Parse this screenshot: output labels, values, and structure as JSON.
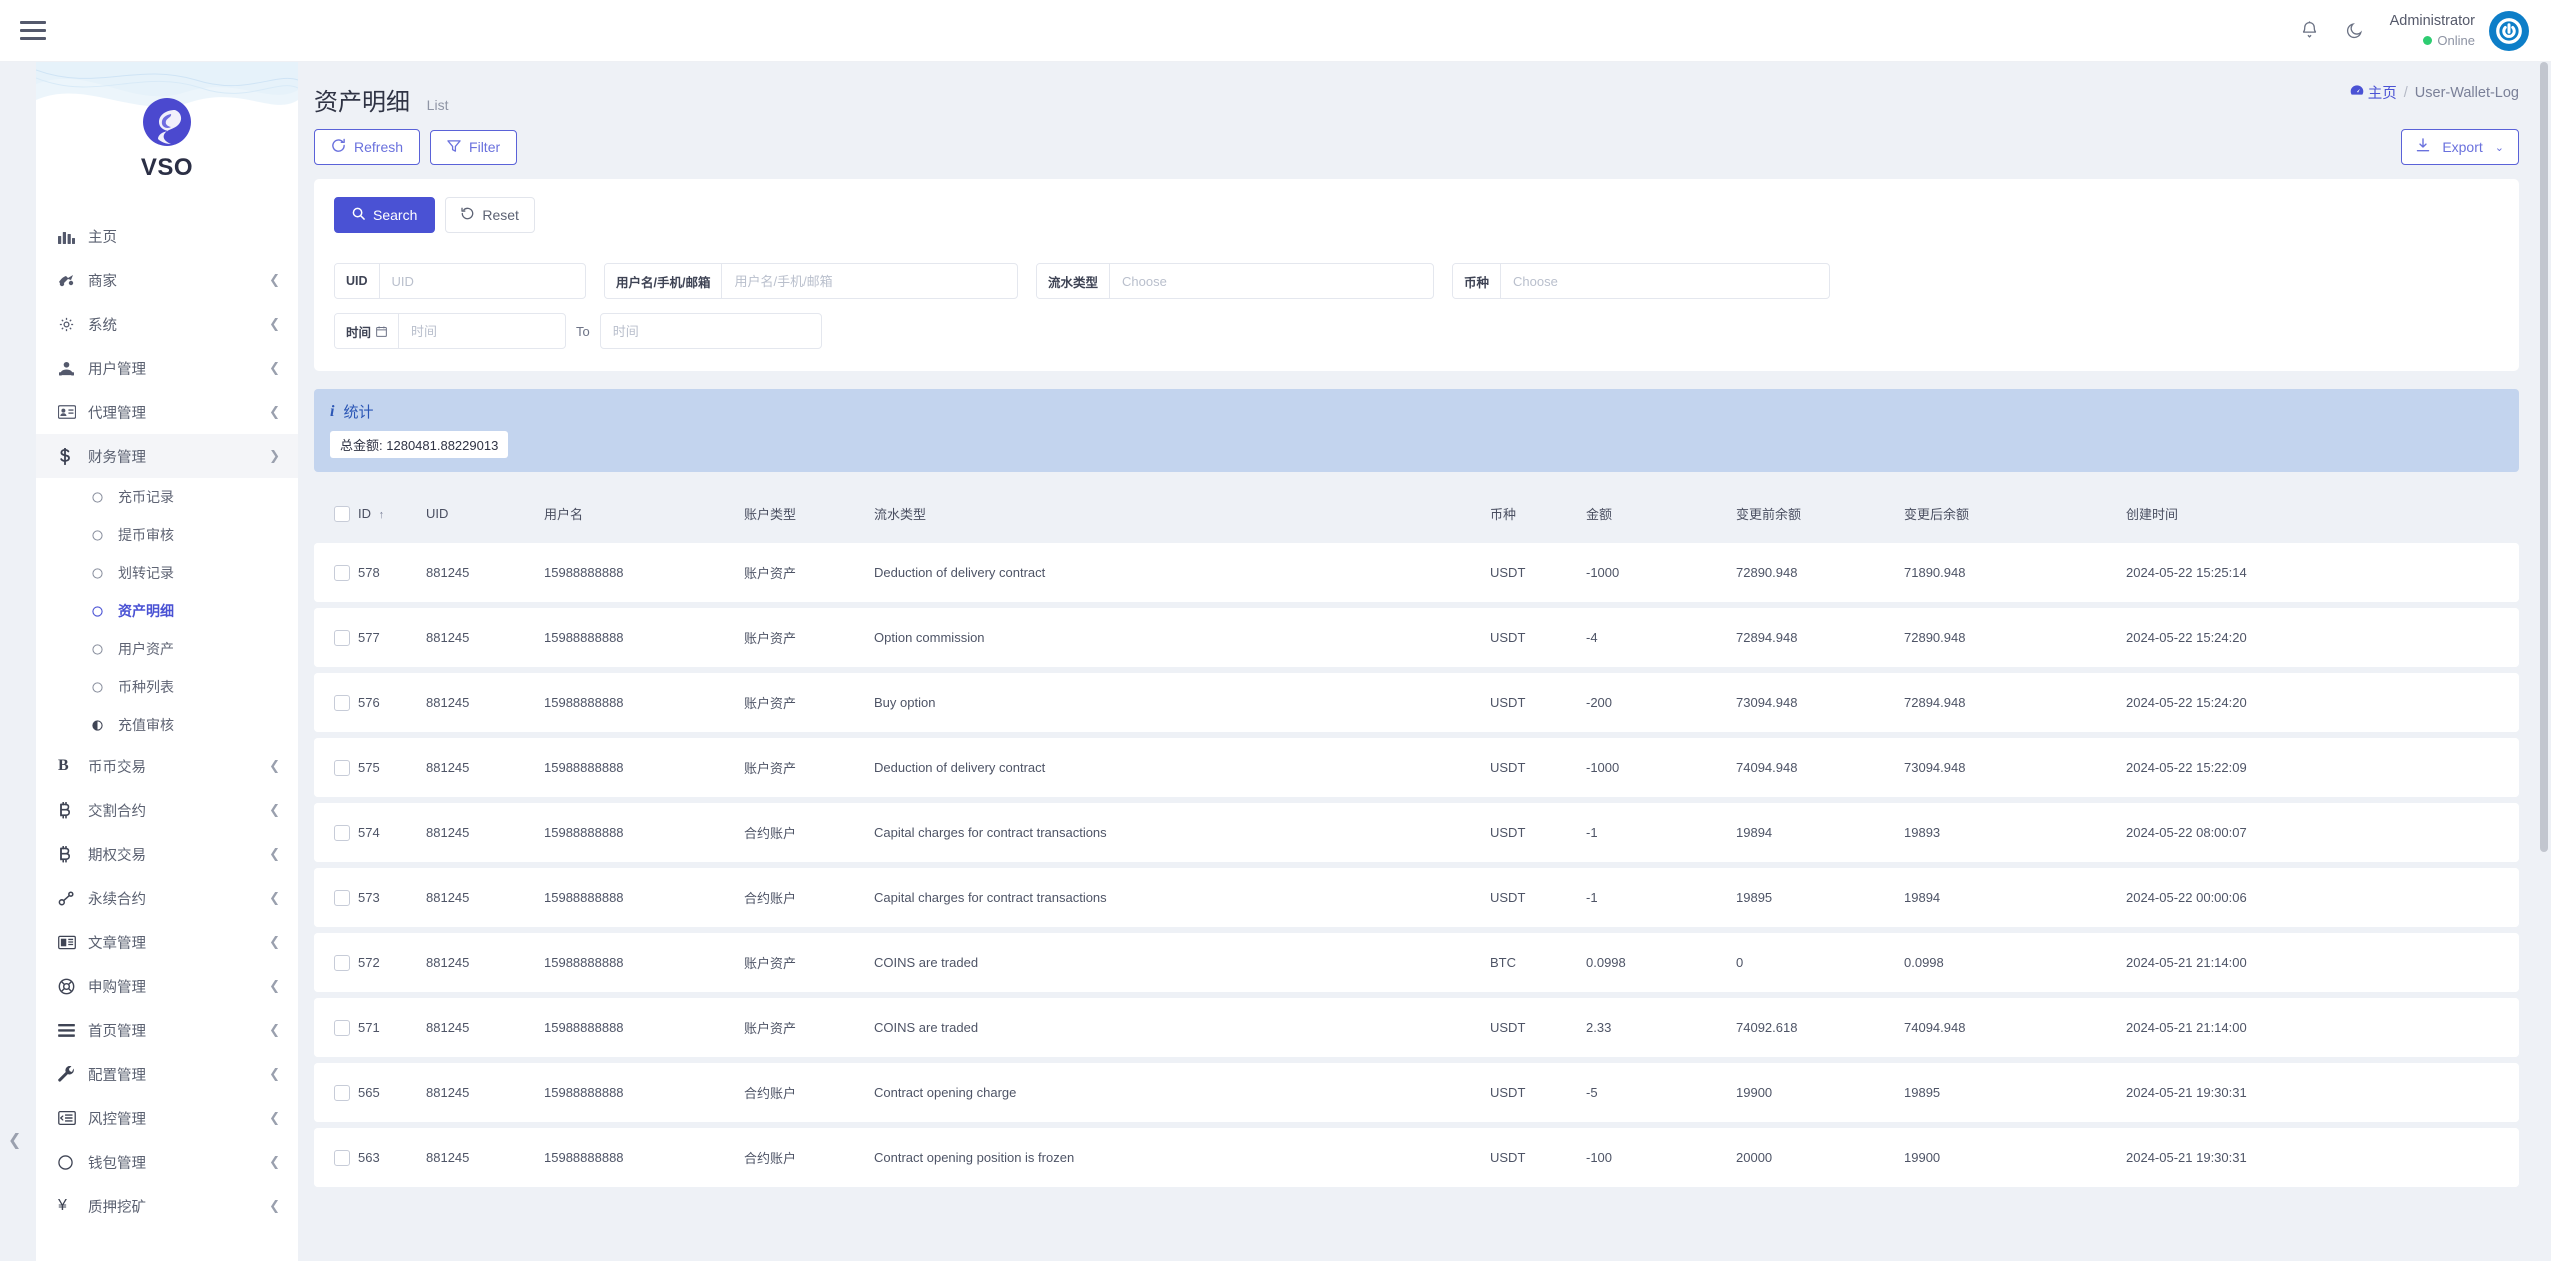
{
  "topbar": {
    "menu_toggle": "hamburger-menu",
    "bell_icon": "bell-icon",
    "theme_icon": "moon-icon",
    "user_name": "Administrator",
    "user_status": "Online"
  },
  "sidebar": {
    "brand": "VSO",
    "items": [
      {
        "label": "主页",
        "icon": "chart-bars-icon",
        "expandable": false
      },
      {
        "label": "商家",
        "icon": "merchant-icon",
        "expandable": true
      },
      {
        "label": "系统",
        "icon": "gear-icon",
        "expandable": true
      },
      {
        "label": "用户管理",
        "icon": "users-icon",
        "expandable": true
      },
      {
        "label": "代理管理",
        "icon": "id-card-icon",
        "expandable": true
      },
      {
        "label": "财务管理",
        "icon": "dollar-icon",
        "expandable": true,
        "active": true
      },
      {
        "label": "币币交易",
        "icon": "letter-b-icon",
        "expandable": true
      },
      {
        "label": "交割合约",
        "icon": "bitcoin-icon",
        "expandable": true
      },
      {
        "label": "期权交易",
        "icon": "bitcoin-icon",
        "expandable": true
      },
      {
        "label": "永续合约",
        "icon": "link-icon",
        "expandable": true
      },
      {
        "label": "文章管理",
        "icon": "newspaper-icon",
        "expandable": true
      },
      {
        "label": "申购管理",
        "icon": "lifebuoy-icon",
        "expandable": true
      },
      {
        "label": "首页管理",
        "icon": "list-icon",
        "expandable": true
      },
      {
        "label": "配置管理",
        "icon": "wrench-icon",
        "expandable": true
      },
      {
        "label": "风控管理",
        "icon": "indent-icon",
        "expandable": true
      },
      {
        "label": "钱包管理",
        "icon": "circle-icon",
        "expandable": true
      },
      {
        "label": "质押挖矿",
        "icon": "yen-icon",
        "expandable": true
      }
    ],
    "finance_submenu": [
      {
        "label": "充币记录",
        "icon": "circle-outline-icon",
        "active": false
      },
      {
        "label": "提币审核",
        "icon": "circle-outline-icon",
        "active": false
      },
      {
        "label": "划转记录",
        "icon": "circle-outline-icon",
        "active": false
      },
      {
        "label": "资产明细",
        "icon": "circle-outline-icon",
        "active": true
      },
      {
        "label": "用户资产",
        "icon": "circle-outline-icon",
        "active": false
      },
      {
        "label": "币种列表",
        "icon": "circle-outline-icon",
        "active": false
      },
      {
        "label": "充值审核",
        "icon": "half-circle-icon",
        "active": false
      }
    ]
  },
  "page": {
    "title": "资产明细",
    "subtitle": "List",
    "breadcrumb_home": "主页",
    "breadcrumb_sep": "/",
    "breadcrumb_current": "User-Wallet-Log",
    "refresh_label": "Refresh",
    "filter_label": "Filter",
    "export_label": "Export",
    "export_chevron": "⌄"
  },
  "search": {
    "search_label": "Search",
    "reset_label": "Reset",
    "fields": {
      "uid_label": "UID",
      "uid_placeholder": "UID",
      "uid_value": "",
      "user_label": "用户名/手机/邮箱",
      "user_placeholder": "用户名/手机/邮箱",
      "user_value": "",
      "flow_label": "流水类型",
      "flow_placeholder": "Choose",
      "flow_value": "",
      "coin_label": "币种",
      "coin_placeholder": "Choose",
      "coin_value": "",
      "time_label": "时间",
      "time_placeholder": "时间",
      "time_value": "",
      "to_label": "To",
      "time_to_placeholder": "时间",
      "time_to_value": ""
    }
  },
  "statistics": {
    "title": "统计",
    "total_label": "总金额:",
    "total_value": "1280481.88229013"
  },
  "table": {
    "columns": [
      "",
      "ID",
      "UID",
      "用户名",
      "账户类型",
      "流水类型",
      "币种",
      "金额",
      "变更前余额",
      "变更后余额",
      "创建时间"
    ],
    "sort_column": "ID",
    "sort_direction": "↑",
    "rows": [
      {
        "id": "578",
        "uid": "881245",
        "username": "15988888888",
        "account_type": "账户资产",
        "flow_type": "Deduction of delivery contract",
        "coin": "USDT",
        "amount": "-1000",
        "amount_sign": "neg",
        "before": "72890.948",
        "after": "71890.948",
        "created": "2024-05-22 15:25:14"
      },
      {
        "id": "577",
        "uid": "881245",
        "username": "15988888888",
        "account_type": "账户资产",
        "flow_type": "Option commission",
        "coin": "USDT",
        "amount": "-4",
        "amount_sign": "neg",
        "before": "72894.948",
        "after": "72890.948",
        "created": "2024-05-22 15:24:20"
      },
      {
        "id": "576",
        "uid": "881245",
        "username": "15988888888",
        "account_type": "账户资产",
        "flow_type": "Buy option",
        "coin": "USDT",
        "amount": "-200",
        "amount_sign": "neg",
        "before": "73094.948",
        "after": "72894.948",
        "created": "2024-05-22 15:24:20"
      },
      {
        "id": "575",
        "uid": "881245",
        "username": "15988888888",
        "account_type": "账户资产",
        "flow_type": "Deduction of delivery contract",
        "coin": "USDT",
        "amount": "-1000",
        "amount_sign": "neg",
        "before": "74094.948",
        "after": "73094.948",
        "created": "2024-05-22 15:22:09"
      },
      {
        "id": "574",
        "uid": "881245",
        "username": "15988888888",
        "account_type": "合约账户",
        "flow_type": "Capital charges for contract transactions",
        "coin": "USDT",
        "amount": "-1",
        "amount_sign": "neg",
        "before": "19894",
        "after": "19893",
        "created": "2024-05-22 08:00:07"
      },
      {
        "id": "573",
        "uid": "881245",
        "username": "15988888888",
        "account_type": "合约账户",
        "flow_type": "Capital charges for contract transactions",
        "coin": "USDT",
        "amount": "-1",
        "amount_sign": "neg",
        "before": "19895",
        "after": "19894",
        "created": "2024-05-22 00:00:06"
      },
      {
        "id": "572",
        "uid": "881245",
        "username": "15988888888",
        "account_type": "账户资产",
        "flow_type": "COINS are traded",
        "coin": "BTC",
        "amount": "0.0998",
        "amount_sign": "pos",
        "before": "0",
        "after": "0.0998",
        "created": "2024-05-21 21:14:00"
      },
      {
        "id": "571",
        "uid": "881245",
        "username": "15988888888",
        "account_type": "账户资产",
        "flow_type": "COINS are traded",
        "coin": "USDT",
        "amount": "2.33",
        "amount_sign": "pos",
        "before": "74092.618",
        "after": "74094.948",
        "created": "2024-05-21 21:14:00"
      },
      {
        "id": "565",
        "uid": "881245",
        "username": "15988888888",
        "account_type": "合约账户",
        "flow_type": "Contract opening charge",
        "coin": "USDT",
        "amount": "-5",
        "amount_sign": "neg",
        "before": "19900",
        "after": "19895",
        "created": "2024-05-21 19:30:31"
      },
      {
        "id": "563",
        "uid": "881245",
        "username": "15988888888",
        "account_type": "合约账户",
        "flow_type": "Contract opening position is frozen",
        "coin": "USDT",
        "amount": "-100",
        "amount_sign": "neg",
        "before": "20000",
        "after": "19900",
        "created": "2024-05-21 19:30:31"
      }
    ]
  },
  "colors": {
    "accent": "#4a52d4",
    "negative": "#e8342a",
    "positive": "#2f9e52",
    "alert_bg": "#c3d4ee",
    "alert_text": "#2b56b5",
    "page_bg": "#eef1f6"
  }
}
